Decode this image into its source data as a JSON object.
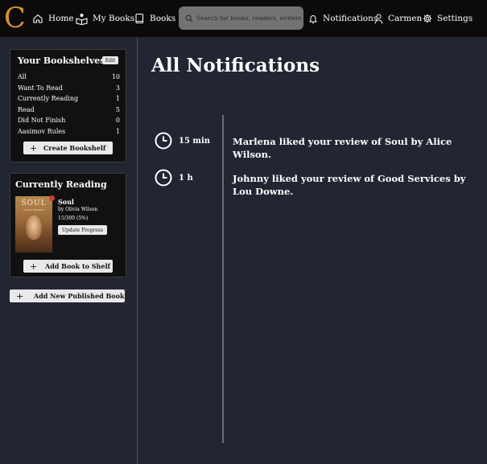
{
  "app": {
    "logo": "C"
  },
  "nav": {
    "home": "Home",
    "my_books": "My Books",
    "books": "Books",
    "search_placeholder": "Search for books, readers, writers ...",
    "notifications": "Notifications",
    "user": "Carmen",
    "settings": "Settings"
  },
  "shelves": {
    "title": "Your Bookshelves",
    "edit_label": "Edit",
    "items": [
      {
        "label": "All",
        "count": "10"
      },
      {
        "label": "Want To Read",
        "count": "3"
      },
      {
        "label": "Currently Reading",
        "count": "1"
      },
      {
        "label": "Read",
        "count": "5"
      },
      {
        "label": "Did Not Finish",
        "count": "0"
      },
      {
        "label": "Aasimov Rules",
        "count": "1"
      }
    ],
    "create_label": "Create Bookshelf"
  },
  "reading": {
    "title": "Currently Reading",
    "cover_title": "SOUL",
    "cover_author": "OLIVIA WILSON",
    "book_title": "Soul",
    "book_author": "by Olivia Wilson",
    "progress": "15/300 (5%)",
    "update_label": "Update Progress",
    "add_label": "Add Book to Shelf"
  },
  "sidebar": {
    "publish_label": "Add New Published Book"
  },
  "main": {
    "title": "All Notifications",
    "notifications": [
      {
        "time": "15 min",
        "text": "Marlena liked your review of Soul by Alice Wilson."
      },
      {
        "time": "1 h",
        "text": "Johnny liked your review of Good Services by Lou Downe."
      }
    ]
  },
  "colors": {
    "accent": "#d9932d",
    "background": "#222633",
    "topbar": "#0b0b0b",
    "card": "#111111",
    "search": "#737373"
  }
}
